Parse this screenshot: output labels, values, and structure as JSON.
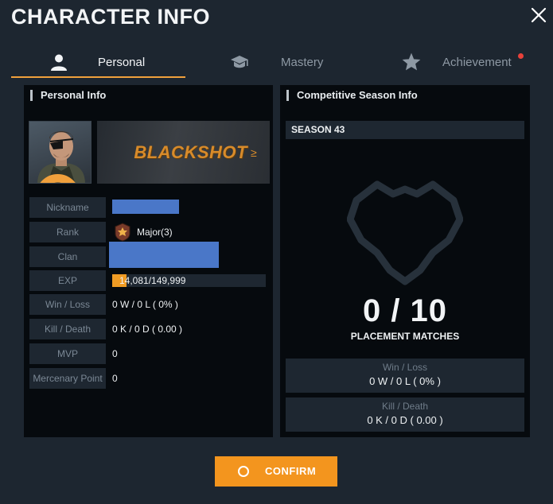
{
  "window": {
    "title": "CHARACTER INFO",
    "close_icon": "close-icon"
  },
  "tabs": [
    {
      "label": "Personal",
      "icon": "person-icon",
      "active": true
    },
    {
      "label": "Mastery",
      "icon": "graduation-cap-icon",
      "active": false
    },
    {
      "label": "Achievement",
      "icon": "star-icon",
      "active": false,
      "has_notification": true
    }
  ],
  "personal_info": {
    "header": "Personal Info",
    "banner_logo": "BLACKSHOT",
    "stats": {
      "nickname_label": "Nickname",
      "rank_label": "Rank",
      "rank_value": "Major(3)",
      "clan_label": "Clan",
      "exp_label": "EXP",
      "exp_value": "14,081/149,999",
      "exp_progress": 0.094,
      "win_loss_label": "Win / Loss",
      "win_loss_value": "0 W / 0 L ( 0% )",
      "kill_death_label": "Kill / Death",
      "kill_death_value": "0 K / 0 D ( 0.00 )",
      "mvp_label": "MVP",
      "mvp_value": "0",
      "mercenary_label": "Mercenary Point",
      "mercenary_value": "0"
    }
  },
  "season_info": {
    "header": "Competitive Season Info",
    "season": "SEASON 43",
    "placement_count": "0 / 10",
    "placement_label": "PLACEMENT MATCHES",
    "win_loss_label": "Win / Loss",
    "win_loss_value": "0 W / 0 L ( 0% )",
    "kill_death_label": "Kill / Death",
    "kill_death_value": "0 K / 0 D ( 0.00 )"
  },
  "footer": {
    "confirm_label": "CONFIRM"
  },
  "colors": {
    "background": "#1d2630",
    "panel": "#060a0e",
    "accent": "#f3951e",
    "redaction": "#4a77c8"
  }
}
